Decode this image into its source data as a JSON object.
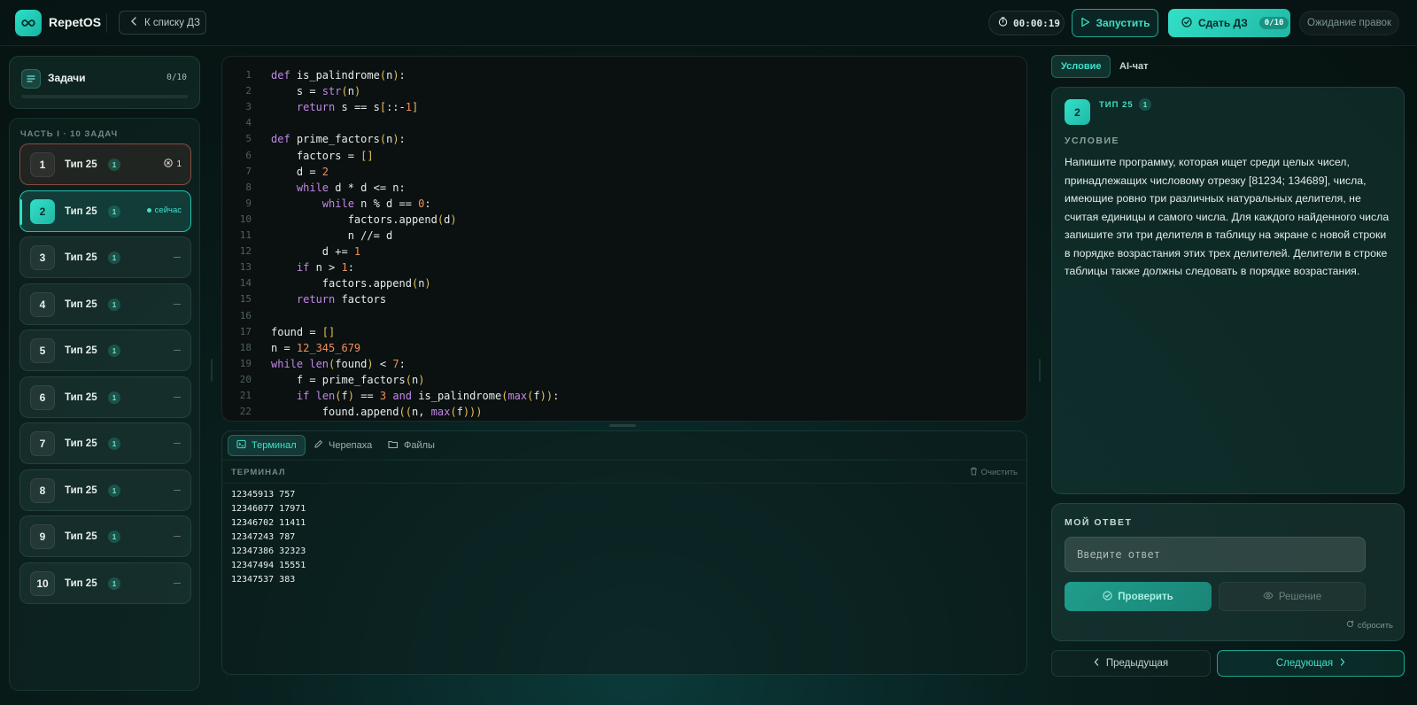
{
  "header": {
    "brand": "RepetOS",
    "back_label": "К списку ДЗ",
    "timer": "00:00:19",
    "run_label": "Запустить",
    "submit_label": "Сдать ДЗ",
    "submit_count": "0/10",
    "await_label": "Ожидание правок"
  },
  "sidebar": {
    "tasks_title": "Задачи",
    "tasks_count": "0/10",
    "section_title": "ЧАСТЬ I · 10 ЗАДАЧ",
    "items": [
      {
        "num": "1",
        "label": "Тип 25",
        "badge": "1",
        "status": "1",
        "state": "error"
      },
      {
        "num": "2",
        "label": "Тип 25",
        "badge": "1",
        "status": "сейчас",
        "state": "active"
      },
      {
        "num": "3",
        "label": "Тип 25",
        "badge": "1",
        "status": "",
        "state": "idle"
      },
      {
        "num": "4",
        "label": "Тип 25",
        "badge": "1",
        "status": "",
        "state": "idle"
      },
      {
        "num": "5",
        "label": "Тип 25",
        "badge": "1",
        "status": "",
        "state": "idle"
      },
      {
        "num": "6",
        "label": "Тип 25",
        "badge": "1",
        "status": "",
        "state": "idle"
      },
      {
        "num": "7",
        "label": "Тип 25",
        "badge": "1",
        "status": "",
        "state": "idle"
      },
      {
        "num": "8",
        "label": "Тип 25",
        "badge": "1",
        "status": "",
        "state": "idle"
      },
      {
        "num": "9",
        "label": "Тип 25",
        "badge": "1",
        "status": "",
        "state": "idle"
      },
      {
        "num": "10",
        "label": "Тип 25",
        "badge": "1",
        "status": "",
        "state": "idle"
      }
    ]
  },
  "editor": {
    "lines": [
      "def is_palindrome(n):",
      "    s = str(n)",
      "    return s == s[::-1]",
      "",
      "def prime_factors(n):",
      "    factors = []",
      "    d = 2",
      "    while d * d <= n:",
      "        while n % d == 0:",
      "            factors.append(d)",
      "            n //= d",
      "        d += 1",
      "    if n > 1:",
      "        factors.append(n)",
      "    return factors",
      "",
      "found = []",
      "n = 12_345_679",
      "while len(found) < 7:",
      "    f = prime_factors(n)",
      "    if len(f) == 3 and is_palindrome(max(f)):",
      "        found.append((n, max(f)))"
    ]
  },
  "terminal": {
    "tabs": [
      "Терминал",
      "Черепаха",
      "Файлы"
    ],
    "title": "ТЕРМИНАЛ",
    "clear_label": "Очистить",
    "output": [
      "12345913 757",
      "12346077 17971",
      "12346702 11411",
      "12347243 787",
      "12347386 32323",
      "12347494 15551",
      "12347537 383"
    ]
  },
  "right": {
    "tabs": [
      "Условие",
      "AI-чат"
    ],
    "task_num": "2",
    "task_type": "ТИП 25",
    "task_badge": "1",
    "condition_head": "УСЛОВИЕ",
    "condition_text": "Напишите программу, которая ищет среди целых чисел, принадлежащих числовому отрезку [81234; 134689], числа, имеющие ровно три различных натуральных делителя, не считая единицы и самого числа. Для каждого найденного числа запишите эти три делителя в таблицу на экране с новой строки в порядке возрастания этих трех делителей. Делители в строке таблицы также должны следовать в порядке возрастания.",
    "answer_head": "МОЙ ОТВЕТ",
    "answer_placeholder": "Введите ответ",
    "check_label": "Проверить",
    "solution_label": "Решение",
    "reset_label": "сбросить",
    "prev_label": "Предыдущая",
    "next_label": "Следующая"
  },
  "colors": {
    "accent": "#2ee0c8",
    "background": "#071614",
    "error_border": "#dc6e5a"
  }
}
